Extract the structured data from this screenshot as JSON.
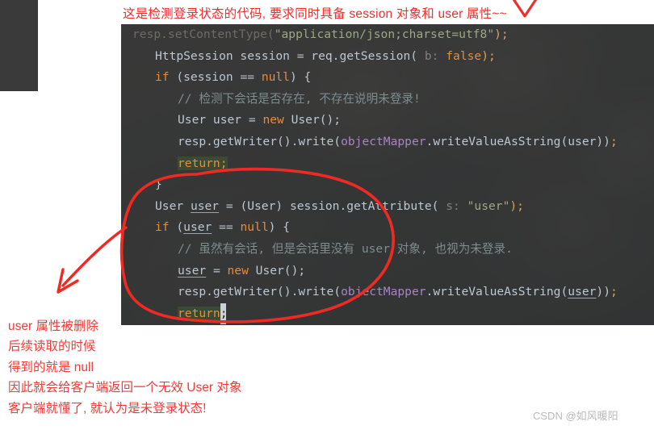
{
  "annotations": {
    "headline": "这是检测登录状态的代码, 要求同时具备 session 对象和 user 属性~~",
    "notes": [
      "user 属性被删除",
      "后续读取的时候",
      "得到的就是 null",
      "因此就会给客户端返回一个无效 User 对象",
      "客户端就懂了, 就认为是未登录状态!"
    ],
    "marker_color": "#ef3b39"
  },
  "watermark": "CSDN @如风暖阳",
  "editor": {
    "background_color": "#3c3f41",
    "lines": [
      {
        "id": "line-0",
        "indent": 0,
        "partial": true,
        "tokens": [
          {
            "t": "resp.setContentType(",
            "c": "plain"
          },
          {
            "t": "\"application/json;charset=utf8\"",
            "c": "str"
          },
          {
            "t": ");",
            "c": "punct"
          }
        ]
      },
      {
        "id": "line-1",
        "indent": 1,
        "tokens": [
          {
            "t": "HttpSession session = req.getSession( ",
            "c": "plain"
          },
          {
            "t": "b:",
            "c": "hint"
          },
          {
            "t": " ",
            "c": "plain"
          },
          {
            "t": "false",
            "c": "kw"
          },
          {
            "t": ");",
            "c": "punct"
          }
        ]
      },
      {
        "id": "line-2",
        "indent": 1,
        "tokens": [
          {
            "t": "if",
            "c": "kw"
          },
          {
            "t": " (session == ",
            "c": "plain"
          },
          {
            "t": "null",
            "c": "kw"
          },
          {
            "t": ") {",
            "c": "plain"
          }
        ]
      },
      {
        "id": "line-3",
        "indent": 2,
        "tokens": [
          {
            "t": "// 检测下会话是否存在, 不存在说明未登录!",
            "c": "cmt"
          }
        ]
      },
      {
        "id": "line-4",
        "indent": 2,
        "tokens": [
          {
            "t": "User user = ",
            "c": "plain"
          },
          {
            "t": "new",
            "c": "kw"
          },
          {
            "t": " User();",
            "c": "plain"
          }
        ]
      },
      {
        "id": "line-5",
        "indent": 2,
        "tokens": [
          {
            "t": "resp.getWriter().write(",
            "c": "plain"
          },
          {
            "t": "objectMapper",
            "c": "field"
          },
          {
            "t": ".writeValueAsString(user))",
            "c": "plain"
          },
          {
            "t": ";",
            "c": "punct"
          }
        ]
      },
      {
        "id": "line-6",
        "indent": 2,
        "tokens": [
          {
            "t": "return;",
            "c": "kw-hl"
          }
        ]
      },
      {
        "id": "line-7",
        "indent": 1,
        "tokens": [
          {
            "t": "}",
            "c": "plain"
          }
        ]
      },
      {
        "id": "line-8",
        "indent": 1,
        "tokens": [
          {
            "t": "User ",
            "c": "plain"
          },
          {
            "t": "user",
            "c": "underline"
          },
          {
            "t": " = (User) session.getAttribute( ",
            "c": "plain"
          },
          {
            "t": "s:",
            "c": "hint"
          },
          {
            "t": " ",
            "c": "plain"
          },
          {
            "t": "\"user\"",
            "c": "str"
          },
          {
            "t": ");",
            "c": "punct"
          }
        ]
      },
      {
        "id": "line-9",
        "indent": 1,
        "tokens": [
          {
            "t": "if",
            "c": "kw"
          },
          {
            "t": " (",
            "c": "plain"
          },
          {
            "t": "user",
            "c": "underline"
          },
          {
            "t": " == ",
            "c": "plain"
          },
          {
            "t": "null",
            "c": "kw"
          },
          {
            "t": ") {",
            "c": "plain"
          }
        ]
      },
      {
        "id": "line-10",
        "indent": 2,
        "tokens": [
          {
            "t": "// 虽然有会话, 但是会话里没有 user 对象, 也视为未登录.",
            "c": "cmt"
          }
        ]
      },
      {
        "id": "line-11",
        "indent": 2,
        "tokens": [
          {
            "t": "user",
            "c": "underline"
          },
          {
            "t": " = ",
            "c": "plain"
          },
          {
            "t": "new",
            "c": "kw"
          },
          {
            "t": " User();",
            "c": "plain"
          }
        ]
      },
      {
        "id": "line-12",
        "indent": 2,
        "tokens": [
          {
            "t": "resp.getWriter().write(",
            "c": "plain"
          },
          {
            "t": "objectMapper",
            "c": "field"
          },
          {
            "t": ".writeValueAsString(",
            "c": "plain"
          },
          {
            "t": "user",
            "c": "underline"
          },
          {
            "t": "))",
            "c": "plain"
          },
          {
            "t": ";",
            "c": "punct"
          }
        ]
      },
      {
        "id": "line-13",
        "indent": 2,
        "tokens": [
          {
            "t": "return",
            "c": "kw-hl"
          },
          {
            "t": ";",
            "c": "caret"
          }
        ]
      },
      {
        "id": "line-14",
        "indent": 1,
        "tokens": [
          {
            "t": "}",
            "c": "plain"
          }
        ]
      }
    ]
  }
}
